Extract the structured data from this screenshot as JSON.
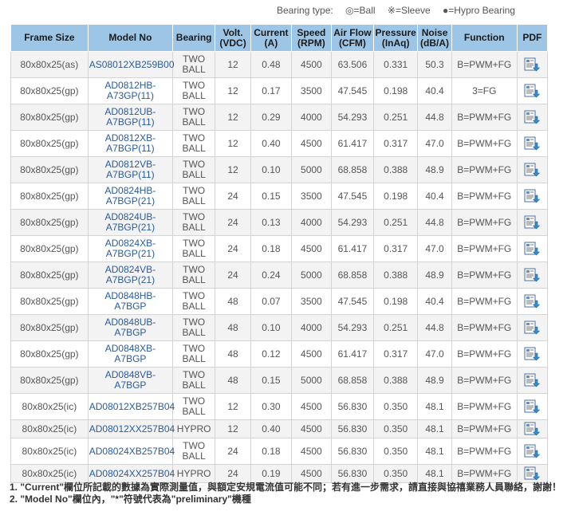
{
  "legend": {
    "label": "Bearing type:",
    "ball": "◎=Ball",
    "sleeve": "※=Sleeve",
    "hypro": "●=Hypro Bearing"
  },
  "headers": [
    "Frame Size",
    "Model No",
    "Bearing",
    "Volt. (VDC)",
    "Current (A)",
    "Speed (RPM)",
    "Air Flow (CFM)",
    "Pressure (InAq)",
    "Noise (dB/A)",
    "Function",
    "PDF"
  ],
  "rows": [
    {
      "frame": "80x80x25(as)",
      "model": "AS08012XB259B00",
      "bearing": "TWO BALL",
      "volt": "12",
      "current": "0.48",
      "speed": "4500",
      "airflow": "63.506",
      "pressure": "0.331",
      "noise": "50.3",
      "function": "B=PWM+FG"
    },
    {
      "frame": "80x80x25(gp)",
      "model": "AD0812HB-A73GP(11)",
      "bearing": "TWO BALL",
      "volt": "12",
      "current": "0.17",
      "speed": "3500",
      "airflow": "47.545",
      "pressure": "0.198",
      "noise": "40.4",
      "function": "3=FG"
    },
    {
      "frame": "80x80x25(gp)",
      "model": "AD0812UB-A7BGP(11)",
      "bearing": "TWO BALL",
      "volt": "12",
      "current": "0.29",
      "speed": "4000",
      "airflow": "54.293",
      "pressure": "0.251",
      "noise": "44.8",
      "function": "B=PWM+FG"
    },
    {
      "frame": "80x80x25(gp)",
      "model": "AD0812XB-A7BGP(11)",
      "bearing": "TWO BALL",
      "volt": "12",
      "current": "0.40",
      "speed": "4500",
      "airflow": "61.417",
      "pressure": "0.317",
      "noise": "47.0",
      "function": "B=PWM+FG"
    },
    {
      "frame": "80x80x25(gp)",
      "model": "AD0812VB-A7BGP(11)",
      "bearing": "TWO BALL",
      "volt": "12",
      "current": "0.10",
      "speed": "5000",
      "airflow": "68.858",
      "pressure": "0.388",
      "noise": "48.9",
      "function": "B=PWM+FG"
    },
    {
      "frame": "80x80x25(gp)",
      "model": "AD0824HB-A7BGP(21)",
      "bearing": "TWO BALL",
      "volt": "24",
      "current": "0.15",
      "speed": "3500",
      "airflow": "47.545",
      "pressure": "0.198",
      "noise": "40.4",
      "function": "B=PWM+FG"
    },
    {
      "frame": "80x80x25(gp)",
      "model": "AD0824UB-A7BGP(21)",
      "bearing": "TWO BALL",
      "volt": "24",
      "current": "0.13",
      "speed": "4000",
      "airflow": "54.293",
      "pressure": "0.251",
      "noise": "44.8",
      "function": "B=PWM+FG"
    },
    {
      "frame": "80x80x25(gp)",
      "model": "AD0824XB-A7BGP(21)",
      "bearing": "TWO BALL",
      "volt": "24",
      "current": "0.18",
      "speed": "4500",
      "airflow": "61.417",
      "pressure": "0.317",
      "noise": "47.0",
      "function": "B=PWM+FG"
    },
    {
      "frame": "80x80x25(gp)",
      "model": "AD0824VB-A7BGP(21)",
      "bearing": "TWO BALL",
      "volt": "24",
      "current": "0.24",
      "speed": "5000",
      "airflow": "68.858",
      "pressure": "0.388",
      "noise": "48.9",
      "function": "B=PWM+FG"
    },
    {
      "frame": "80x80x25(gp)",
      "model": "AD0848HB-A7BGP",
      "bearing": "TWO BALL",
      "volt": "48",
      "current": "0.07",
      "speed": "3500",
      "airflow": "47.545",
      "pressure": "0.198",
      "noise": "40.4",
      "function": "B=PWM+FG"
    },
    {
      "frame": "80x80x25(gp)",
      "model": "AD0848UB-A7BGP",
      "bearing": "TWO BALL",
      "volt": "48",
      "current": "0.10",
      "speed": "4000",
      "airflow": "54.293",
      "pressure": "0.251",
      "noise": "44.8",
      "function": "B=PWM+FG"
    },
    {
      "frame": "80x80x25(gp)",
      "model": "AD0848XB-A7BGP",
      "bearing": "TWO BALL",
      "volt": "48",
      "current": "0.12",
      "speed": "4500",
      "airflow": "61.417",
      "pressure": "0.317",
      "noise": "47.0",
      "function": "B=PWM+FG"
    },
    {
      "frame": "80x80x25(gp)",
      "model": "AD0848VB-A7BGP",
      "bearing": "TWO BALL",
      "volt": "48",
      "current": "0.15",
      "speed": "5000",
      "airflow": "68.858",
      "pressure": "0.388",
      "noise": "48.9",
      "function": "B=PWM+FG"
    },
    {
      "frame": "80x80x25(ic)",
      "model": "AD08012XB257B04",
      "bearing": "TWO BALL",
      "volt": "12",
      "current": "0.30",
      "speed": "4500",
      "airflow": "56.830",
      "pressure": "0.350",
      "noise": "48.1",
      "function": "B=PWM+FG"
    },
    {
      "frame": "80x80x25(ic)",
      "model": "AD08012XX257B04",
      "bearing": "HYPRO",
      "volt": "12",
      "current": "0.40",
      "speed": "4500",
      "airflow": "56.830",
      "pressure": "0.350",
      "noise": "48.1",
      "function": "B=PWM+FG"
    },
    {
      "frame": "80x80x25(ic)",
      "model": "AD08024XB257B04",
      "bearing": "TWO BALL",
      "volt": "24",
      "current": "0.18",
      "speed": "4500",
      "airflow": "56.830",
      "pressure": "0.350",
      "noise": "48.1",
      "function": "B=PWM+FG"
    },
    {
      "frame": "80x80x25(ic)",
      "model": "AD08024XX257B04",
      "bearing": "HYPRO",
      "volt": "24",
      "current": "0.19",
      "speed": "4500",
      "airflow": "56.830",
      "pressure": "0.350",
      "noise": "48.1",
      "function": "B=PWM+FG"
    }
  ],
  "notes": [
    "1. \"Current\"欄位所記載的數據為實際測量值，與額定安規電流值可能不同；若有進一步需求，請直接與協禧業務人員聯絡，謝謝！",
    "2. \"Model No\"欄位內，\"*\"符號代表為\"preliminary\"機種"
  ],
  "colors": {
    "header_bg": "#9dc6e6",
    "link": "#2a5b9b",
    "row_alt": "#f3f3f3"
  },
  "icons": {
    "pdf": "pdf-download-icon"
  }
}
